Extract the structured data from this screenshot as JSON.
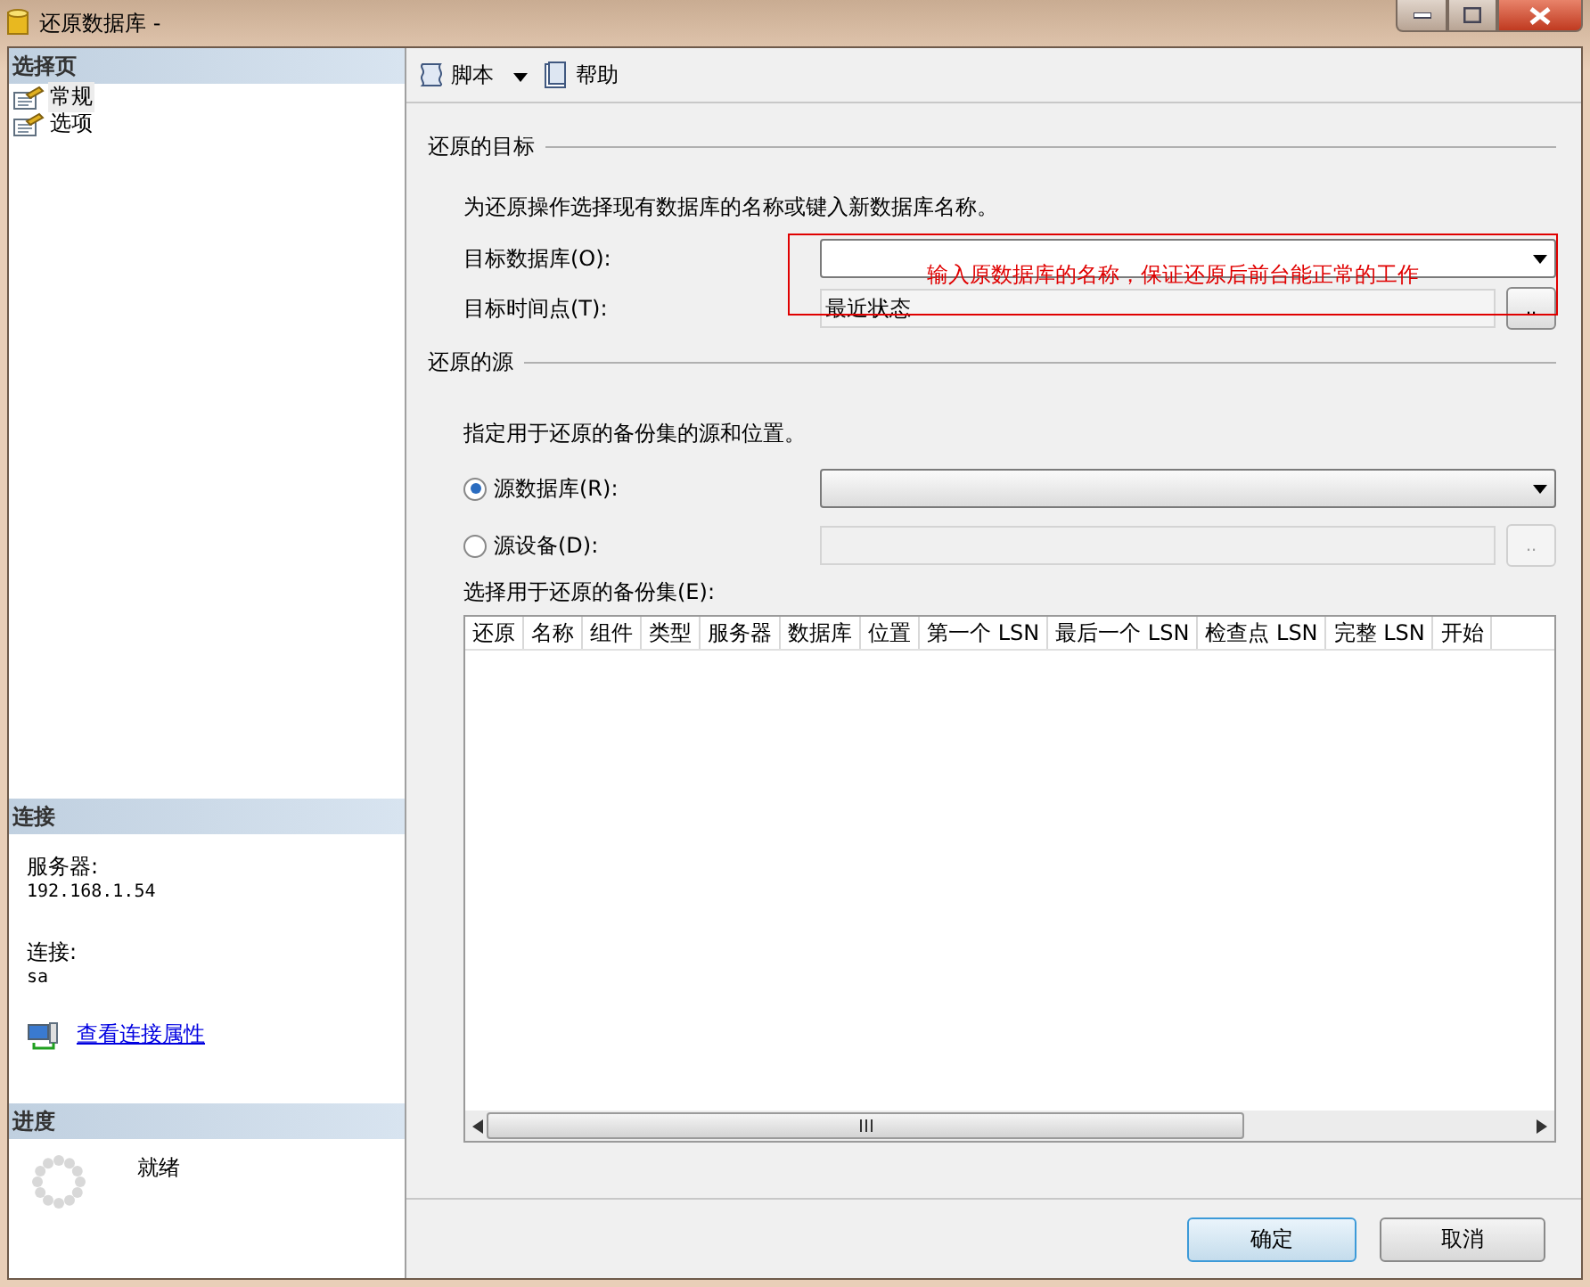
{
  "window": {
    "title": "还原数据库 -"
  },
  "sidebar": {
    "pages_header": "选择页",
    "pages": [
      {
        "label": "常规",
        "selected": true
      },
      {
        "label": "选项",
        "selected": false
      }
    ],
    "connection": {
      "header": "连接",
      "server_label": "服务器:",
      "server": "192.168.1.54",
      "connection_label": "连接:",
      "user": "sa",
      "link": "查看连接属性"
    },
    "progress": {
      "header": "进度",
      "status": "就绪"
    }
  },
  "toolbar": [
    {
      "label": "脚本",
      "kind": "dropdown"
    },
    {
      "label": "帮助",
      "kind": "button"
    }
  ],
  "destination": {
    "header": "还原的目标",
    "hint": "为还原操作选择现有数据库的名称或键入新数据库名称。",
    "database_label": "目标数据库(O):",
    "time_label": "目标时间点(T):",
    "time_value": "最近状态",
    "browse": ".."
  },
  "annotation": {
    "text": "输入原数据库的名称，保证还原后前台能正常的工作"
  },
  "source": {
    "header": "还原的源",
    "hint": "指定用于还原的备份集的源和位置。",
    "options": [
      {
        "label": "源数据库(R):",
        "selected": true,
        "kind": "dropdown"
      },
      {
        "label": "源设备(D):",
        "selected": false,
        "kind": "file",
        "browse": ".."
      }
    ],
    "backup_sets_label": "选择用于还原的备份集(E):",
    "columns": [
      "还原",
      "名称",
      "组件",
      "类型",
      "服务器",
      "数据库",
      "位置",
      "第一个 LSN",
      "最后一个 LSN",
      "检查点 LSN",
      "完整 LSN",
      "开始"
    ]
  },
  "buttons": [
    {
      "label": "确定",
      "default": true
    },
    {
      "label": "取消",
      "default": false
    }
  ]
}
